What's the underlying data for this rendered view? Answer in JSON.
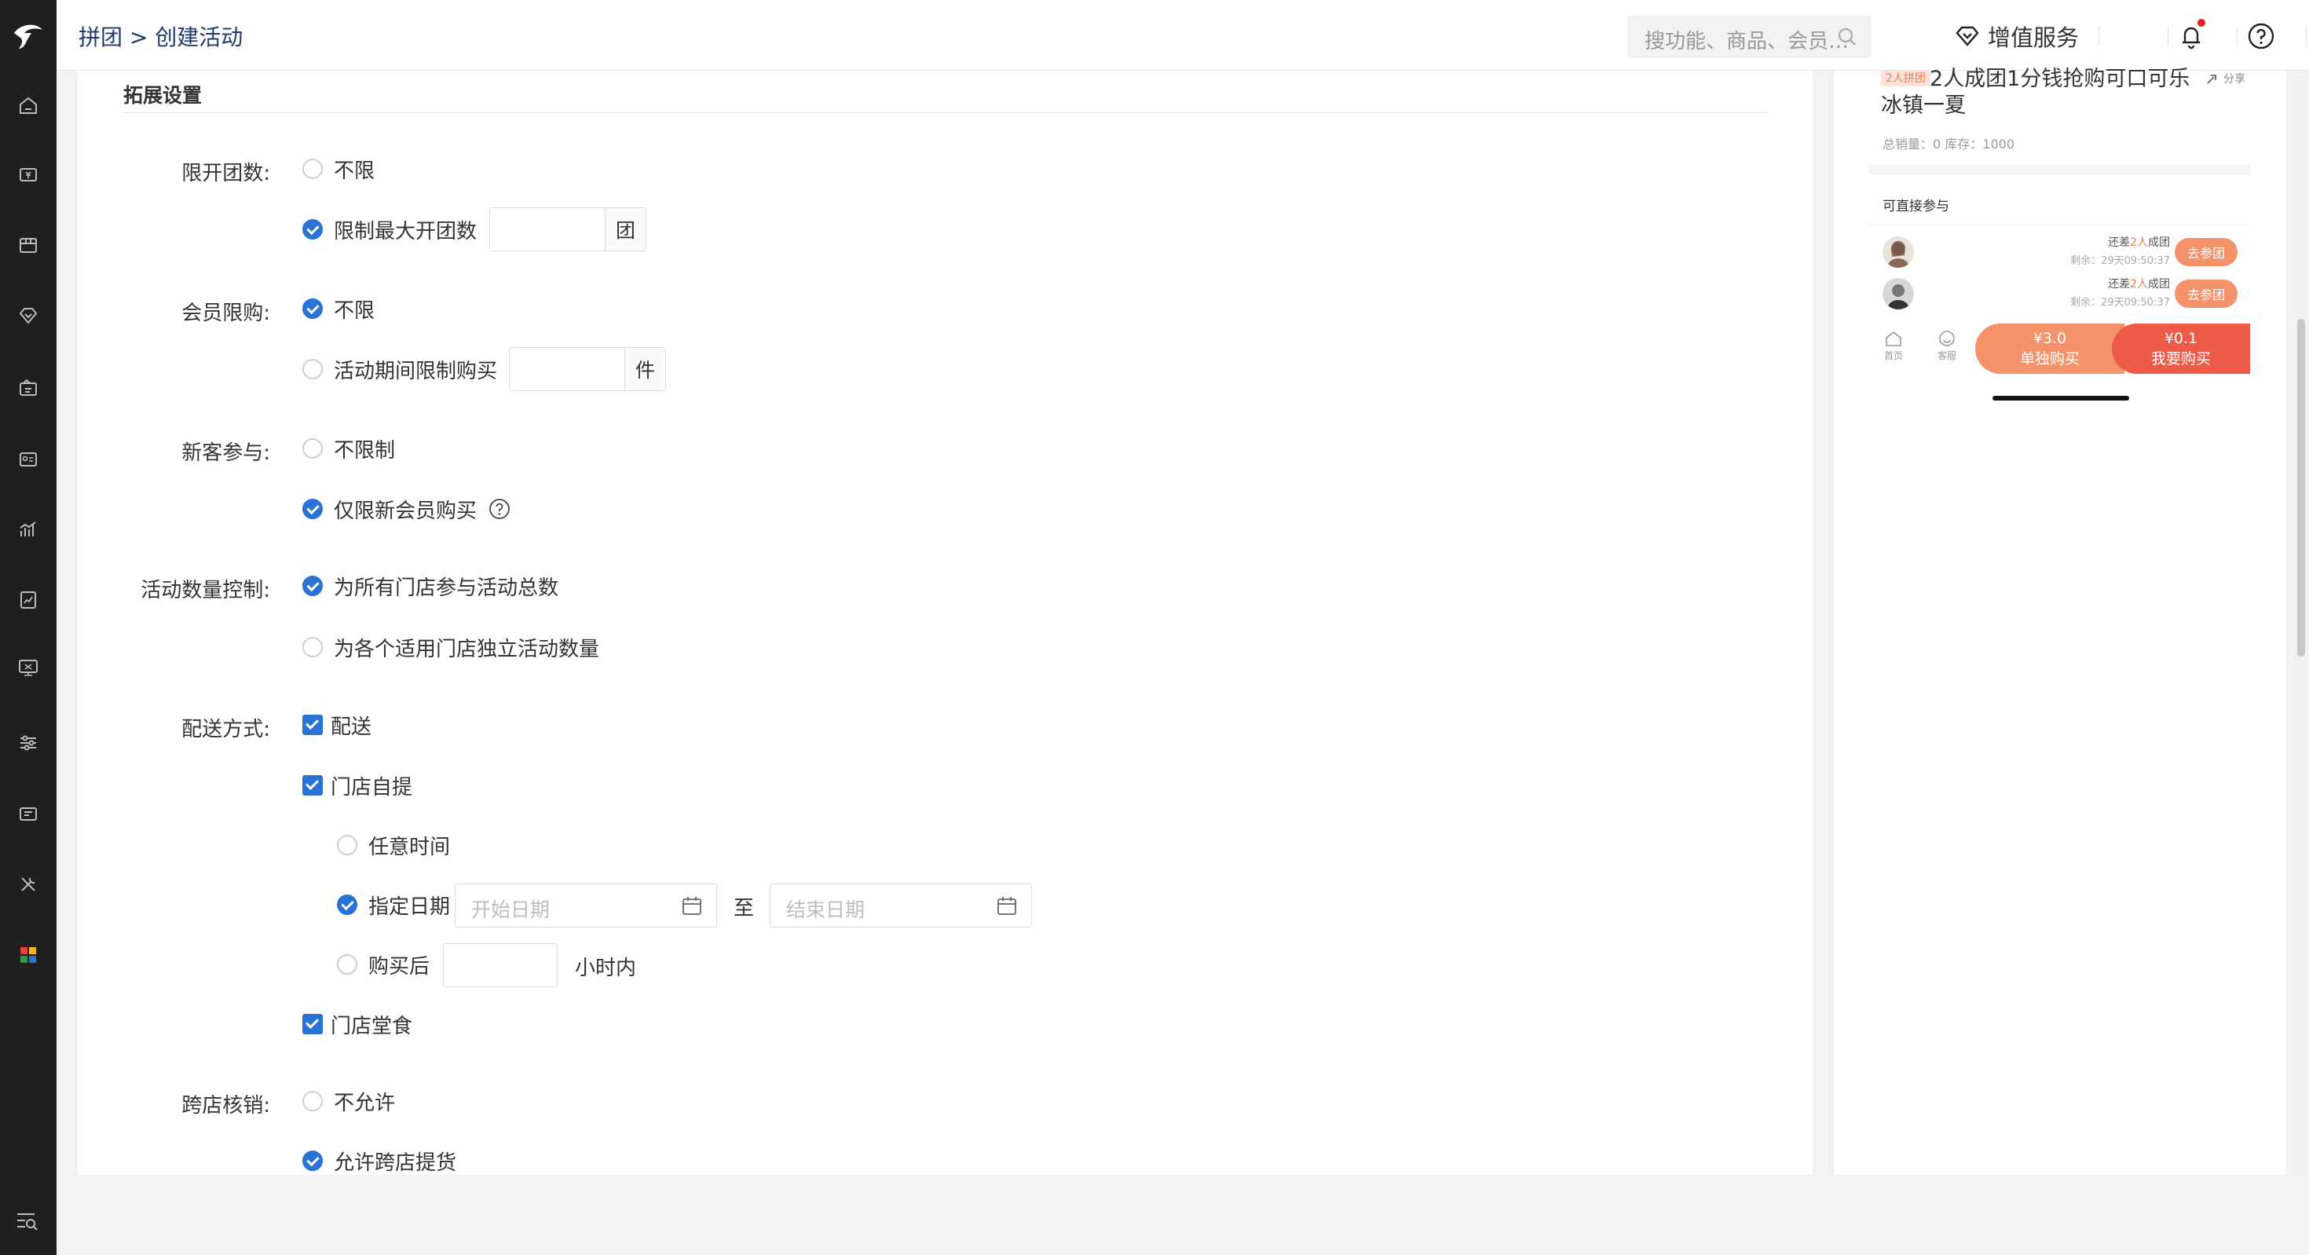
{
  "header": {
    "breadcrumb_parent": "拼团",
    "breadcrumb_sep": ">",
    "breadcrumb_current": "创建活动",
    "search_placeholder": "搜功能、商品、会员…",
    "value_added": "增值服务"
  },
  "form": {
    "section_title": "拓展设置",
    "group_limit": {
      "label": "限开团数:",
      "opt_unlimited": "不限",
      "opt_limited": "限制最大开团数",
      "unit": "团",
      "selected": "limited"
    },
    "member_limit": {
      "label": "会员限购:",
      "opt_unlimited": "不限",
      "opt_limited": "活动期间限制购买",
      "unit": "件",
      "selected": "unlimited"
    },
    "new_customer": {
      "label": "新客参与:",
      "opt_unlimited": "不限制",
      "opt_new_only": "仅限新会员购买",
      "selected": "new_only"
    },
    "quantity_control": {
      "label": "活动数量控制:",
      "opt_total": "为所有门店参与活动总数",
      "opt_each": "为各个适用门店独立活动数量",
      "selected": "total"
    },
    "delivery": {
      "label": "配送方式:",
      "opt_delivery": "配送",
      "opt_pickup": "门店自提",
      "pickup_any_time": "任意时间",
      "pickup_date": "指定日期",
      "start_date_placeholder": "开始日期",
      "to": "至",
      "end_date_placeholder": "结束日期",
      "pickup_after": "购买后",
      "hours_within": "小时内",
      "pickup_selected": "date",
      "opt_dine_in": "门店堂食"
    },
    "cross_store": {
      "label": "跨店核销:",
      "opt_disallow": "不允许",
      "opt_allow": "允许跨店提货",
      "selected": "allow"
    }
  },
  "preview": {
    "tag": "2人拼团",
    "title": "2人成团1分钱抢购可口可乐冰镇一夏",
    "share": "分享",
    "stats": "总销量：0   库存：1000",
    "direct_join": "可直接参与",
    "rows": [
      {
        "short_prefix": "还差",
        "short_num": "2人",
        "short_suffix": "成团",
        "remain": "剩余：29天09:50:37",
        "go": "去参团"
      },
      {
        "short_prefix": "还差",
        "short_num": "2人",
        "short_suffix": "成团",
        "remain": "剩余：29天09:50:37",
        "go": "去参团"
      }
    ],
    "tab_home": "首页",
    "tab_service": "客服",
    "price_single": "¥3.0",
    "btn_single": "单独购买",
    "price_group": "¥0.1",
    "btn_group": "我要购买"
  },
  "colors": {
    "primary": "#2a73d6",
    "accent_orange": "#f4926b",
    "accent_red": "#ee5a48",
    "sidebar": "#1f1f1f"
  }
}
